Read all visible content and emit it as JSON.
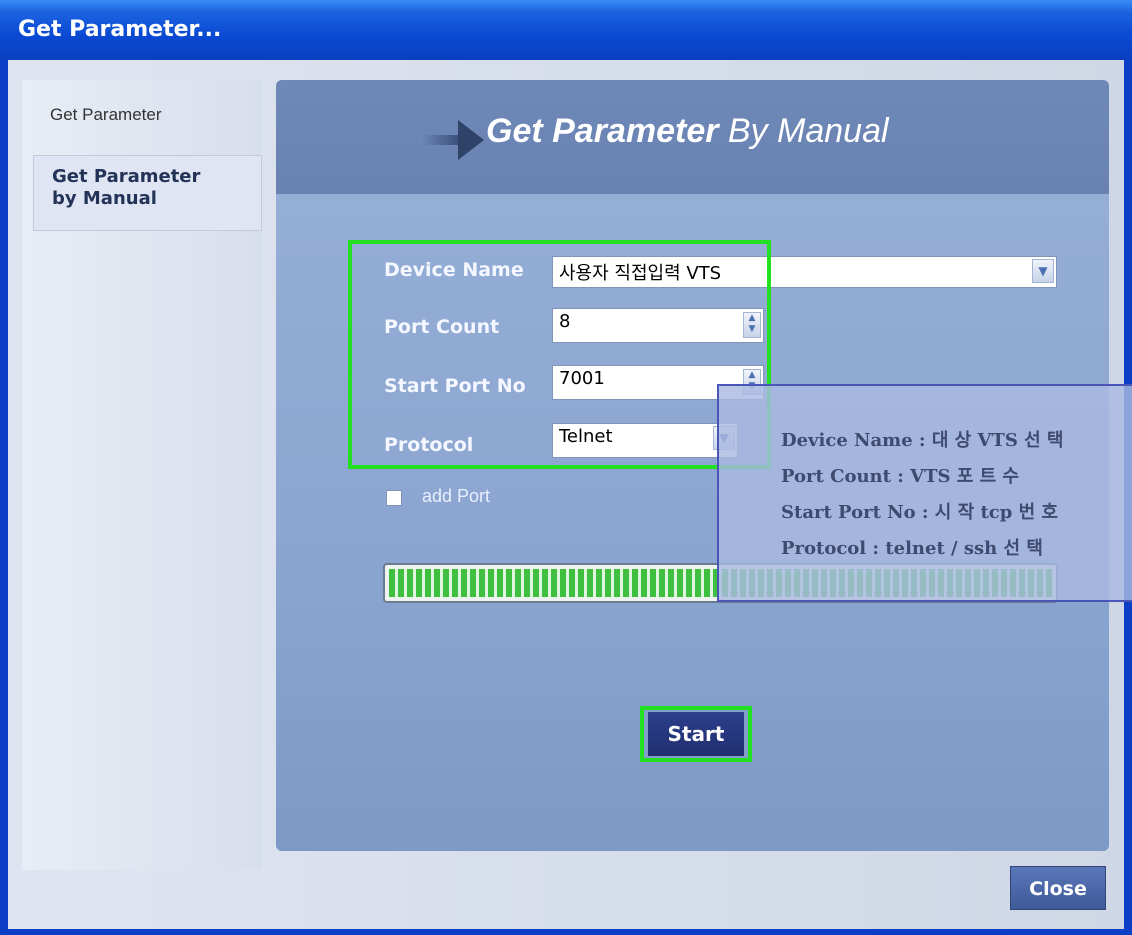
{
  "window": {
    "title": "Get Parameter..."
  },
  "sidebar": {
    "items": [
      {
        "label": "Get Parameter"
      },
      {
        "label_line1": "Get Parameter",
        "label_line2": "by Manual"
      }
    ]
  },
  "panel": {
    "title_bold": "Get Parameter",
    "title_rest": " By Manual"
  },
  "form": {
    "device_name_label": "Device Name",
    "device_name_value": "사용자 직접입력 VTS",
    "port_count_label": "Port Count",
    "port_count_value": "8",
    "start_port_label": "Start Port No",
    "start_port_value": "7001",
    "protocol_label": "Protocol",
    "protocol_value": "Telnet",
    "add_port_label": "add Port",
    "add_port_checked": false
  },
  "progress": {
    "value_fraction": 1.0
  },
  "tooltip": {
    "lines": [
      "Device Name : 대 상  VTS 선 택",
      "Port Count : VTS 포 트 수",
      "Start Port No : 시 작  tcp 번 호",
      "Protocol : telnet / ssh 선 택"
    ]
  },
  "buttons": {
    "start": "Start",
    "close": "Close"
  },
  "colors": {
    "highlight": "#23e023",
    "title_bar": "#0a49d2",
    "panel": "#8ca5cf"
  }
}
